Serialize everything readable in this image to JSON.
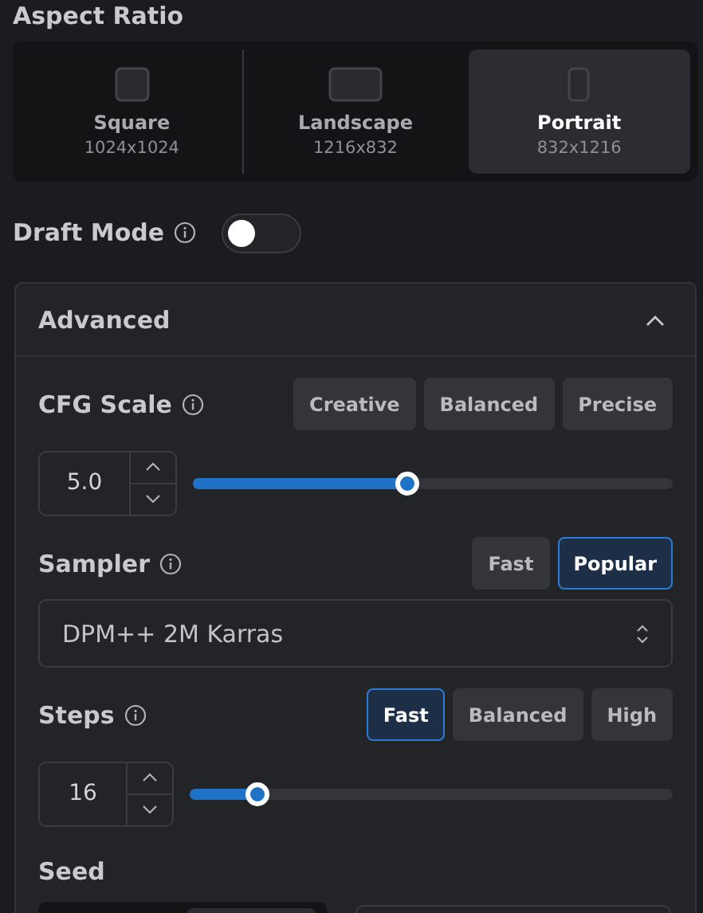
{
  "aspect_ratio": {
    "title": "Aspect Ratio",
    "options": [
      {
        "kind": "square",
        "label": "Square",
        "size": "1024x1024",
        "selected": false
      },
      {
        "kind": "landscape",
        "label": "Landscape",
        "size": "1216x832",
        "selected": false
      },
      {
        "kind": "portrait",
        "label": "Portrait",
        "size": "832x1216",
        "selected": true
      }
    ]
  },
  "draft_mode": {
    "label": "Draft Mode",
    "on": false
  },
  "advanced": {
    "title": "Advanced",
    "expanded": true,
    "cfg_scale": {
      "label": "CFG Scale",
      "presets": [
        {
          "label": "Creative",
          "selected": false
        },
        {
          "label": "Balanced",
          "selected": false
        },
        {
          "label": "Precise",
          "selected": false
        }
      ],
      "value": "5.0",
      "level": 0.445
    },
    "sampler": {
      "label": "Sampler",
      "presets": [
        {
          "label": "Fast",
          "selected": false
        },
        {
          "label": "Popular",
          "selected": true
        }
      ],
      "value": "DPM++ 2M Karras"
    },
    "steps": {
      "label": "Steps",
      "presets": [
        {
          "label": "Fast",
          "selected": true
        },
        {
          "label": "Balanced",
          "selected": false
        },
        {
          "label": "High",
          "selected": false
        }
      ],
      "value": "16",
      "level": 0.137
    },
    "seed": {
      "label": "Seed"
    }
  }
}
